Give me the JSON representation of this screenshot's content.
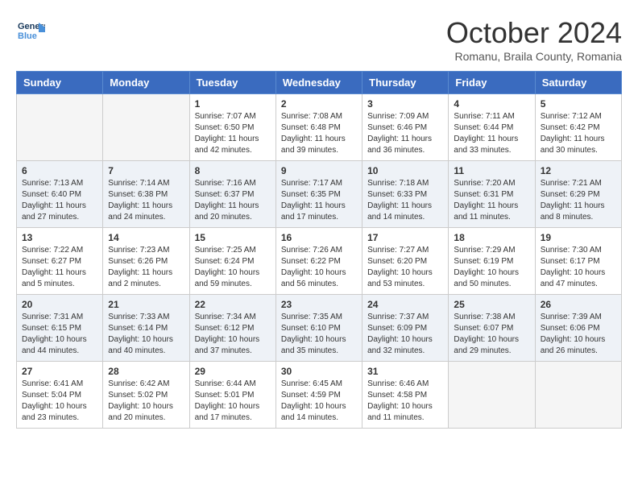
{
  "header": {
    "logo_line1": "General",
    "logo_line2": "Blue",
    "month_title": "October 2024",
    "location": "Romanu, Braila County, Romania"
  },
  "weekdays": [
    "Sunday",
    "Monday",
    "Tuesday",
    "Wednesday",
    "Thursday",
    "Friday",
    "Saturday"
  ],
  "weeks": [
    [
      {
        "day": "",
        "info": ""
      },
      {
        "day": "",
        "info": ""
      },
      {
        "day": "1",
        "info": "Sunrise: 7:07 AM\nSunset: 6:50 PM\nDaylight: 11 hours and 42 minutes."
      },
      {
        "day": "2",
        "info": "Sunrise: 7:08 AM\nSunset: 6:48 PM\nDaylight: 11 hours and 39 minutes."
      },
      {
        "day": "3",
        "info": "Sunrise: 7:09 AM\nSunset: 6:46 PM\nDaylight: 11 hours and 36 minutes."
      },
      {
        "day": "4",
        "info": "Sunrise: 7:11 AM\nSunset: 6:44 PM\nDaylight: 11 hours and 33 minutes."
      },
      {
        "day": "5",
        "info": "Sunrise: 7:12 AM\nSunset: 6:42 PM\nDaylight: 11 hours and 30 minutes."
      }
    ],
    [
      {
        "day": "6",
        "info": "Sunrise: 7:13 AM\nSunset: 6:40 PM\nDaylight: 11 hours and 27 minutes."
      },
      {
        "day": "7",
        "info": "Sunrise: 7:14 AM\nSunset: 6:38 PM\nDaylight: 11 hours and 24 minutes."
      },
      {
        "day": "8",
        "info": "Sunrise: 7:16 AM\nSunset: 6:37 PM\nDaylight: 11 hours and 20 minutes."
      },
      {
        "day": "9",
        "info": "Sunrise: 7:17 AM\nSunset: 6:35 PM\nDaylight: 11 hours and 17 minutes."
      },
      {
        "day": "10",
        "info": "Sunrise: 7:18 AM\nSunset: 6:33 PM\nDaylight: 11 hours and 14 minutes."
      },
      {
        "day": "11",
        "info": "Sunrise: 7:20 AM\nSunset: 6:31 PM\nDaylight: 11 hours and 11 minutes."
      },
      {
        "day": "12",
        "info": "Sunrise: 7:21 AM\nSunset: 6:29 PM\nDaylight: 11 hours and 8 minutes."
      }
    ],
    [
      {
        "day": "13",
        "info": "Sunrise: 7:22 AM\nSunset: 6:27 PM\nDaylight: 11 hours and 5 minutes."
      },
      {
        "day": "14",
        "info": "Sunrise: 7:23 AM\nSunset: 6:26 PM\nDaylight: 11 hours and 2 minutes."
      },
      {
        "day": "15",
        "info": "Sunrise: 7:25 AM\nSunset: 6:24 PM\nDaylight: 10 hours and 59 minutes."
      },
      {
        "day": "16",
        "info": "Sunrise: 7:26 AM\nSunset: 6:22 PM\nDaylight: 10 hours and 56 minutes."
      },
      {
        "day": "17",
        "info": "Sunrise: 7:27 AM\nSunset: 6:20 PM\nDaylight: 10 hours and 53 minutes."
      },
      {
        "day": "18",
        "info": "Sunrise: 7:29 AM\nSunset: 6:19 PM\nDaylight: 10 hours and 50 minutes."
      },
      {
        "day": "19",
        "info": "Sunrise: 7:30 AM\nSunset: 6:17 PM\nDaylight: 10 hours and 47 minutes."
      }
    ],
    [
      {
        "day": "20",
        "info": "Sunrise: 7:31 AM\nSunset: 6:15 PM\nDaylight: 10 hours and 44 minutes."
      },
      {
        "day": "21",
        "info": "Sunrise: 7:33 AM\nSunset: 6:14 PM\nDaylight: 10 hours and 40 minutes."
      },
      {
        "day": "22",
        "info": "Sunrise: 7:34 AM\nSunset: 6:12 PM\nDaylight: 10 hours and 37 minutes."
      },
      {
        "day": "23",
        "info": "Sunrise: 7:35 AM\nSunset: 6:10 PM\nDaylight: 10 hours and 35 minutes."
      },
      {
        "day": "24",
        "info": "Sunrise: 7:37 AM\nSunset: 6:09 PM\nDaylight: 10 hours and 32 minutes."
      },
      {
        "day": "25",
        "info": "Sunrise: 7:38 AM\nSunset: 6:07 PM\nDaylight: 10 hours and 29 minutes."
      },
      {
        "day": "26",
        "info": "Sunrise: 7:39 AM\nSunset: 6:06 PM\nDaylight: 10 hours and 26 minutes."
      }
    ],
    [
      {
        "day": "27",
        "info": "Sunrise: 6:41 AM\nSunset: 5:04 PM\nDaylight: 10 hours and 23 minutes."
      },
      {
        "day": "28",
        "info": "Sunrise: 6:42 AM\nSunset: 5:02 PM\nDaylight: 10 hours and 20 minutes."
      },
      {
        "day": "29",
        "info": "Sunrise: 6:44 AM\nSunset: 5:01 PM\nDaylight: 10 hours and 17 minutes."
      },
      {
        "day": "30",
        "info": "Sunrise: 6:45 AM\nSunset: 4:59 PM\nDaylight: 10 hours and 14 minutes."
      },
      {
        "day": "31",
        "info": "Sunrise: 6:46 AM\nSunset: 4:58 PM\nDaylight: 10 hours and 11 minutes."
      },
      {
        "day": "",
        "info": ""
      },
      {
        "day": "",
        "info": ""
      }
    ]
  ]
}
